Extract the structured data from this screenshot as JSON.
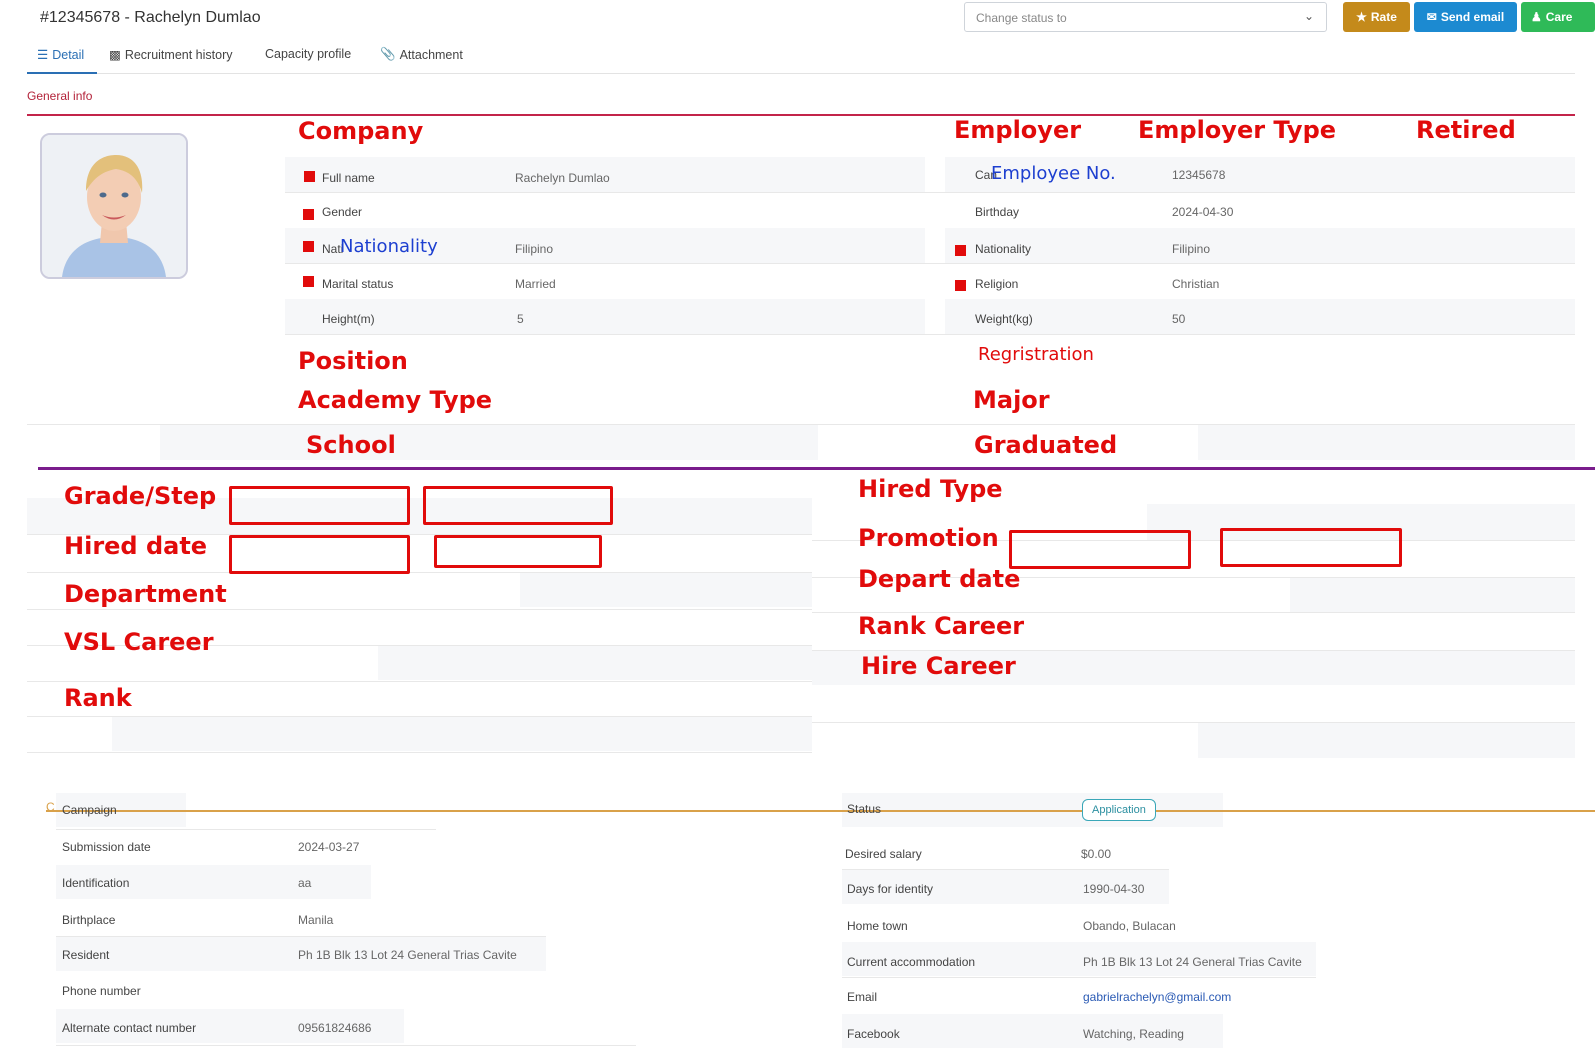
{
  "header": {
    "title": "#12345678 - Rachelyn Dumlao",
    "status_placeholder": "Change status to",
    "buttons": {
      "rate": "Rate",
      "send_email": "Send email",
      "care": "Care"
    }
  },
  "tabs": [
    "Detail",
    "Recruitment history",
    "Capacity profile",
    "Attachment"
  ],
  "section": "General info",
  "annotations": {
    "company": "Company",
    "employer": "Employer",
    "employer_type": "Employer Type",
    "retired": "Retired",
    "employee_no": "Employee No.",
    "nationality": "Nationality",
    "position": "Position",
    "registration": "Regristration",
    "academy_type": "Academy Type",
    "major": "Major",
    "school": "School",
    "graduated": "Graduated",
    "grade_step": "Grade/Step",
    "hired_type": "Hired Type",
    "hired_date": "Hired date",
    "promotion": "Promotion",
    "department": "Department",
    "depart_date": "Depart date",
    "vsl_career": "VSL Career",
    "rank_career": "Rank Career",
    "hire_career": "Hire Career",
    "rank": "Rank"
  },
  "general": {
    "full_name_label": "Full name",
    "full_name": "Rachelyn Dumlao",
    "gender_label": "Gender",
    "nationality_left_label": "Nati",
    "nationality_left": "Filipino",
    "marital_label": "Marital status",
    "marital": "Married",
    "height_label": "Height(m)",
    "height": "5",
    "candidate_label": "Can",
    "candidate_no": "12345678",
    "birthday_label": "Birthday",
    "birthday": "2024-04-30",
    "nationality_label": "Nationality",
    "nationality": "Filipino",
    "religion_label": "Religion",
    "religion": "Christian",
    "weight_label": "Weight(kg)",
    "weight": "50"
  },
  "bottom": {
    "section_stub": "C",
    "campaign_label": "Campaign",
    "status_label": "Status",
    "status": "Application",
    "submission_label": "Submission date",
    "submission": "2024-03-27",
    "salary_label": "Desired salary",
    "salary": "$0.00",
    "identification_label": "Identification",
    "identification": "aa",
    "days_label": "Days for identity",
    "days": "1990-04-30",
    "birthplace_label": "Birthplace",
    "birthplace": "Manila",
    "hometown_label": "Home town",
    "hometown": "Obando, Bulacan",
    "resident_label": "Resident",
    "resident": "Ph 1B Blk 13 Lot 24 General Trias Cavite",
    "accommodation_label": "Current accommodation",
    "accommodation": "Ph 1B Blk 13 Lot 24 General Trias Cavite",
    "phone_label": "Phone number",
    "email_label": "Email",
    "email": "gabrielrachelyn@gmail.com",
    "alt_label": "Alternate contact number",
    "alt": "09561824686",
    "facebook_label": "Facebook",
    "facebook": "Watching, Reading"
  }
}
